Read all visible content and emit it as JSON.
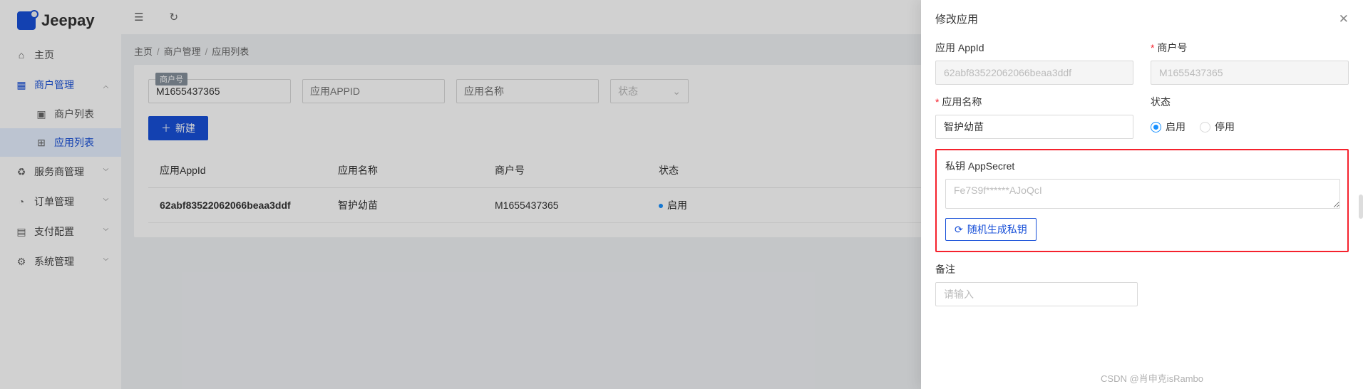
{
  "brand": {
    "name": "Jeepay"
  },
  "sidebar": {
    "items": [
      {
        "label": "主页",
        "icon": "home"
      },
      {
        "label": "商户管理",
        "icon": "apps",
        "active": true,
        "expanded": true,
        "children": [
          {
            "label": "商户列表",
            "icon": "list"
          },
          {
            "label": "应用列表",
            "icon": "grid",
            "selected": true
          }
        ]
      },
      {
        "label": "服务商管理",
        "icon": "svc"
      },
      {
        "label": "订单管理",
        "icon": "order"
      },
      {
        "label": "支付配置",
        "icon": "pay"
      },
      {
        "label": "系统管理",
        "icon": "sys"
      }
    ]
  },
  "breadcrumb": {
    "a": "主页",
    "b": "商户管理",
    "c": "应用列表"
  },
  "filters": {
    "mch_label": "商户号",
    "mch_value": "M1655437365",
    "appid_placeholder": "应用APPID",
    "appname_placeholder": "应用名称",
    "status_placeholder": "状态"
  },
  "buttons": {
    "new": "新建"
  },
  "table": {
    "headers": {
      "appid": "应用AppId",
      "appname": "应用名称",
      "mch": "商户号",
      "status": "状态"
    },
    "rows": [
      {
        "appid": "62abf83522062066beaa3ddf",
        "appname": "智护幼苗",
        "mch": "M1655437365",
        "status": "启用"
      }
    ]
  },
  "drawer": {
    "title": "修改应用",
    "fields": {
      "appid_label": "应用 AppId",
      "appid_value": "62abf83522062066beaa3ddf",
      "mch_label": "商户号",
      "mch_value": "M1655437365",
      "appname_label": "应用名称",
      "appname_value": "智护幼苗",
      "status_label": "状态",
      "status_enable": "启用",
      "status_disable": "停用",
      "secret_label": "私钥 AppSecret",
      "secret_value": "Fe7S9f******AJoQcI",
      "gen_btn": "随机生成私钥",
      "remark_label": "备注",
      "remark_placeholder": "请输入"
    }
  },
  "watermark": "CSDN @肖申克isRambo"
}
